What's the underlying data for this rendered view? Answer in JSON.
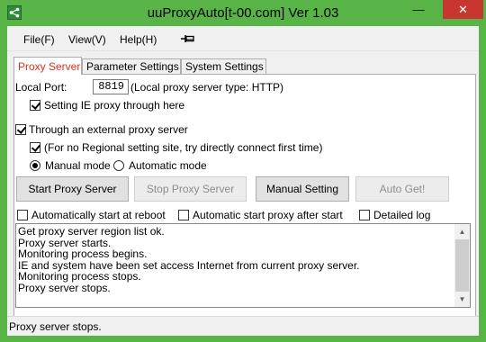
{
  "window": {
    "title": "uuProxyAuto[t-00.com] Ver 1.03",
    "controls": {
      "minimize": "—",
      "maximize": "▢",
      "close": "✕"
    },
    "icon": "share-icon"
  },
  "menu": {
    "items": [
      "File(F)",
      "View(V)",
      "Help(H)"
    ],
    "pin_icon": "pin-icon"
  },
  "tabs": [
    "Proxy Server",
    "Parameter Settings",
    "System Settings"
  ],
  "proxy": {
    "local_port_label": "Local Port:",
    "local_port_value": "8819",
    "local_port_note": "(Local proxy server type: HTTP)",
    "setting_ie_label": "Setting IE proxy through here",
    "setting_ie_checked": true,
    "through_external_label": "Through an external proxy server",
    "through_external_checked": true,
    "no_regional_label": "(For no Regional setting site, try directly connect first time)",
    "no_regional_checked": true,
    "manual_mode_label": "Manual mode",
    "automatic_mode_label": "Automatic mode",
    "mode_selected": "Manual mode"
  },
  "buttons": {
    "start": "Start Proxy Server",
    "stop": "Stop Proxy Server",
    "manual": "Manual Setting",
    "auto_get": "Auto Get!"
  },
  "options": {
    "auto_reboot": "Automatically start at reboot",
    "auto_after_start": "Automatic start proxy after start",
    "detailed_log": "Detailed log"
  },
  "log": [
    "Get proxy server region list ok.",
    "Proxy server starts.",
    "Monitoring process begins.",
    "IE and system have been set access Internet from current proxy server.",
    "Monitoring process stops.",
    "Proxy server stops."
  ],
  "status": {
    "text": "Proxy server stops."
  },
  "colors": {
    "title_bar": "#58b447",
    "close_button": "#c7372f",
    "active_tab_text": "#e0301e"
  }
}
